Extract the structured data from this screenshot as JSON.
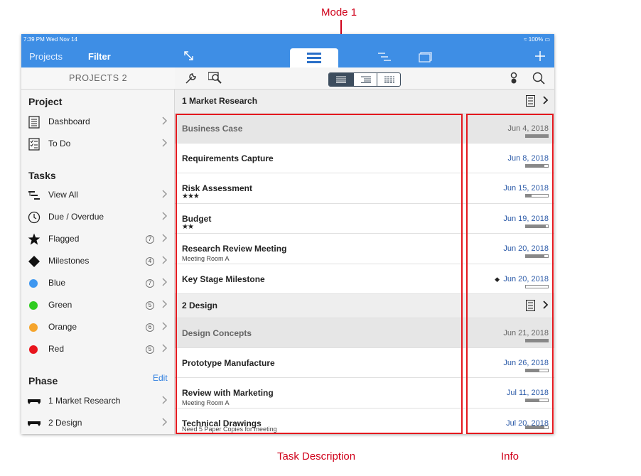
{
  "annotations": {
    "mode": "Mode 1",
    "task_description": "Task Description",
    "info": "Info"
  },
  "status_bar": {
    "time": "7:39 PM  Wed Nov 14",
    "battery": "100%"
  },
  "sidebar": {
    "tabs": [
      "Projects",
      "Filter"
    ],
    "title": "PROJECTS 2",
    "project_section": "Project",
    "project_items": [
      {
        "label": "Dashboard",
        "icon": "dashboard-icon"
      },
      {
        "label": "To Do",
        "icon": "todo-icon"
      }
    ],
    "tasks_section": "Tasks",
    "task_items": [
      {
        "label": "View All",
        "icon": "view-all-icon"
      },
      {
        "label": "Due / Overdue",
        "icon": "clock-icon"
      },
      {
        "label": "Flagged",
        "icon": "star-icon",
        "badge": "7"
      },
      {
        "label": "Milestones",
        "icon": "diamond-icon",
        "badge": "4"
      },
      {
        "label": "Blue",
        "color": "#3e97f0",
        "badge": "7"
      },
      {
        "label": "Green",
        "color": "#2ecc1f",
        "badge": "5"
      },
      {
        "label": "Orange",
        "color": "#f5a42c",
        "badge": "6"
      },
      {
        "label": "Red",
        "color": "#e8141c",
        "badge": "5"
      }
    ],
    "phase_section": "Phase",
    "edit_label": "Edit",
    "phase_items": [
      {
        "label": "1 Market Research",
        "icon": "phase-icon"
      },
      {
        "label": "2 Design",
        "icon": "phase-icon"
      }
    ]
  },
  "main": {
    "groups": [
      {
        "title": "1 Market Research",
        "tasks": [
          {
            "title": "Business Case",
            "date": "Jun 4, 2018",
            "progress": 1.0,
            "summary": true
          },
          {
            "title": "Requirements Capture",
            "date": "Jun 8, 2018",
            "progress": 0.85
          },
          {
            "title": "Risk Assessment",
            "stars": "★★★",
            "date": "Jun 15, 2018",
            "progress": 0.25
          },
          {
            "title": "Budget",
            "stars": "★★",
            "date": "Jun 19, 2018",
            "progress": 0.9
          },
          {
            "title": "Research Review Meeting",
            "note": "Meeting Room A",
            "date": "Jun 20, 2018",
            "progress": 0.85
          },
          {
            "title": "Key Stage Milestone",
            "date": "Jun 20, 2018",
            "progress": 0.0,
            "milestone": true
          }
        ]
      },
      {
        "title": "2 Design",
        "tasks": [
          {
            "title": "Design Concepts",
            "date": "Jun 21, 2018",
            "progress": 1.0,
            "summary": true
          },
          {
            "title": "Prototype Manufacture",
            "date": "Jun 26, 2018",
            "progress": 0.6
          },
          {
            "title": "Review with Marketing",
            "note": "Meeting Room A",
            "date": "Jul 11, 2018",
            "progress": 0.6
          },
          {
            "title": "Technical Drawings",
            "note": "Need 5 Paper Copies for meeting",
            "date": "Jul 20, 2018",
            "progress": 0.85
          }
        ]
      }
    ]
  },
  "colors": {
    "accent": "#3e8ee5",
    "annotation_red": "#e4181e",
    "segment_selected": "#3d4d5e"
  }
}
